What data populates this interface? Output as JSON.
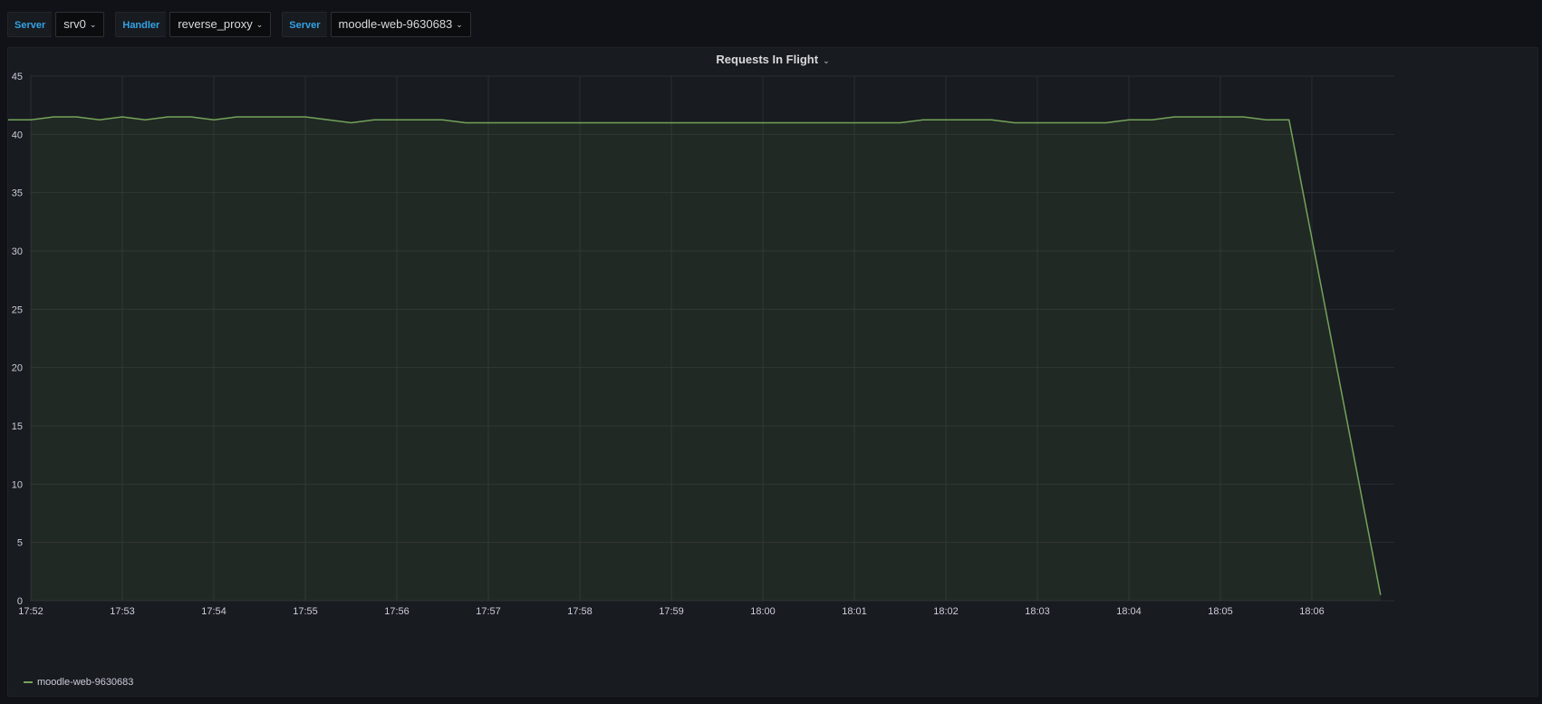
{
  "variables": [
    {
      "label": "Server",
      "value": "srv0"
    },
    {
      "label": "Handler",
      "value": "reverse_proxy"
    },
    {
      "label": "Server",
      "value": "moodle-web-9630683"
    }
  ],
  "panel": {
    "title": "Requests In Flight"
  },
  "colors": {
    "series": "#73a35a",
    "accent": "#33a2e5"
  },
  "icons": {
    "dropdown": "chevron-down-icon"
  },
  "chart_data": {
    "type": "area",
    "title": "Requests In Flight",
    "xlabel": "",
    "ylabel": "",
    "ylim": [
      0,
      45
    ],
    "yticks": [
      0,
      5,
      10,
      15,
      20,
      25,
      30,
      35,
      40,
      45
    ],
    "xticks": [
      "17:52",
      "17:53",
      "17:54",
      "17:55",
      "17:56",
      "17:57",
      "17:58",
      "17:59",
      "18:00",
      "18:01",
      "18:02",
      "18:03",
      "18:04",
      "18:05",
      "18:06"
    ],
    "grid": true,
    "legend_position": "bottom-left",
    "series": [
      {
        "name": "moodle-web-9630683",
        "color": "#73a35a",
        "x": [
          "17:51:45",
          "17:52:00",
          "17:52:15",
          "17:52:30",
          "17:52:45",
          "17:53:00",
          "17:53:15",
          "17:53:30",
          "17:53:45",
          "17:54:00",
          "17:54:15",
          "17:54:30",
          "17:54:45",
          "17:55:00",
          "17:55:15",
          "17:55:30",
          "17:55:45",
          "17:56:00",
          "17:56:15",
          "17:56:30",
          "17:56:45",
          "17:57:00",
          "17:57:15",
          "17:57:30",
          "17:57:45",
          "17:58:00",
          "17:58:15",
          "17:58:30",
          "17:58:45",
          "17:59:00",
          "17:59:15",
          "17:59:30",
          "17:59:45",
          "18:00:00",
          "18:00:15",
          "18:00:30",
          "18:00:45",
          "18:01:00",
          "18:01:15",
          "18:01:30",
          "18:01:45",
          "18:02:00",
          "18:02:15",
          "18:02:30",
          "18:02:45",
          "18:03:00",
          "18:03:15",
          "18:03:30",
          "18:03:45",
          "18:04:00",
          "18:04:15",
          "18:04:30",
          "18:04:45",
          "18:05:00",
          "18:05:15",
          "18:05:30",
          "18:05:45",
          "18:06:45"
        ],
        "values": [
          41.25,
          41.25,
          41.5,
          41.5,
          41.25,
          41.5,
          41.25,
          41.5,
          41.5,
          41.25,
          41.5,
          41.5,
          41.5,
          41.5,
          41.25,
          41.0,
          41.25,
          41.25,
          41.25,
          41.25,
          41.0,
          41.0,
          41.0,
          41.0,
          41.0,
          41.0,
          41.0,
          41.0,
          41.0,
          41.0,
          41.0,
          41.0,
          41.0,
          41.0,
          41.0,
          41.0,
          41.0,
          41.0,
          41.0,
          41.0,
          41.25,
          41.25,
          41.25,
          41.25,
          41.0,
          41.0,
          41.0,
          41.0,
          41.0,
          41.25,
          41.25,
          41.5,
          41.5,
          41.5,
          41.5,
          41.25,
          41.25,
          0.5
        ]
      }
    ]
  }
}
